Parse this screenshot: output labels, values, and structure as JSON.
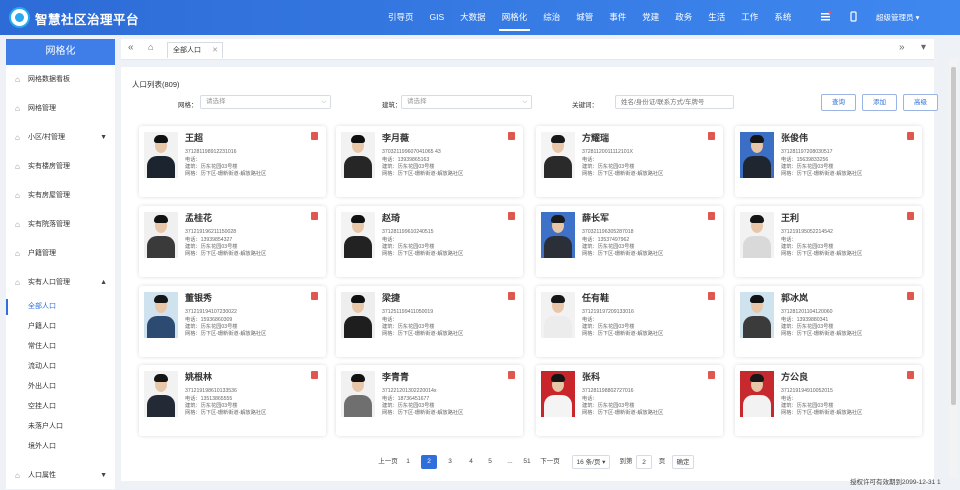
{
  "app": {
    "title": "智慧社区治理平台"
  },
  "topnav": [
    "引导页",
    "GIS",
    "大数据",
    "网格化",
    "综治",
    "城管",
    "事件",
    "党建",
    "政务",
    "生活",
    "工作",
    "系统"
  ],
  "topbar_icons": [
    "hamburger-icon",
    "bell-icon",
    "phone-icon",
    "user-icon"
  ],
  "user": {
    "name": "超级管理员 ▾"
  },
  "sidebar": {
    "title": "网格化",
    "items": [
      {
        "label": "网格数据看板",
        "caret": ""
      },
      {
        "label": "网格管理",
        "caret": ""
      },
      {
        "label": "小区/村管理",
        "caret": "▼"
      },
      {
        "label": "实有楼房管理",
        "caret": ""
      },
      {
        "label": "实有房屋管理",
        "caret": ""
      },
      {
        "label": "实有院落管理",
        "caret": ""
      },
      {
        "label": "户籍管理",
        "caret": ""
      },
      {
        "label": "实有人口管理",
        "caret": "▲"
      }
    ],
    "sub": [
      "全部人口",
      "户籍人口",
      "常住人口",
      "流动人口",
      "外出人口",
      "空挂人口",
      "未落户人口",
      "境外人口"
    ],
    "last": {
      "label": "人口属性",
      "caret": "▼"
    }
  },
  "tabbar": {
    "prev": "«",
    "home": "⌂",
    "tab": "全部人口",
    "tab_close": "✕",
    "next": "»",
    "menu": "▾"
  },
  "content": {
    "title": "人口列表(809)",
    "filters": {
      "grid_label": "网格：",
      "grid_placeholder": "请选择",
      "build_label": "建筑：",
      "build_placeholder": "请选择",
      "kw_label": "关键词：",
      "kw_placeholder": "姓名/身份证/联系方式/车牌号"
    },
    "buttons": {
      "query": "查询",
      "add": "添加",
      "advanced": "高级"
    }
  },
  "people": [
    {
      "name": "王超",
      "id": "371281198912231016",
      "phone": "电话：",
      "building": "建筑：历东花园03号楼",
      "grid": "网格：历下区-珊新街道-解放路社区",
      "bg": "#f2f2f2",
      "cloth": "#1c2430",
      "hair": "#111111"
    },
    {
      "name": "李月薇",
      "id": "370321199607041065 43",
      "phone": "电话：13939865163",
      "building": "建筑：历东花园03号楼",
      "grid": "网格：历下区-珊新街道-解放路社区",
      "bg": "#f2f2f2",
      "cloth": "#262626",
      "hair": "#0e0e0e"
    },
    {
      "name": "方耀瑞",
      "id": "37281120011112101X",
      "phone": "电话：",
      "building": "建筑：历东花园03号楼",
      "grid": "网格：历下区-珊新街道-解放路社区",
      "bg": "#f4f4f4",
      "cloth": "#2a2a2a",
      "hair": "#181818"
    },
    {
      "name": "张俊伟",
      "id": "371281197208030517",
      "phone": "电话：15639833256",
      "building": "建筑：历东花园03号楼",
      "grid": "网格：历下区-珊新街道-解放路社区",
      "bg": "#3b6fc6",
      "cloth": "#1f2630",
      "hair": "#161616"
    },
    {
      "name": "孟桂花",
      "id": "371219196211150028",
      "phone": "电话：13939854327",
      "building": "建筑：历东花园03号楼",
      "grid": "网格：历下区-珊新街道-解放路社区",
      "bg": "#f0f0f0",
      "cloth": "#3a3a3a",
      "hair": "#121212"
    },
    {
      "name": "赵琦",
      "id": "371281199610240515",
      "phone": "电话：",
      "building": "建筑：历东花园03号楼",
      "grid": "网格：历下区-珊新街道-解放路社区",
      "bg": "#f3f3f3",
      "cloth": "#222222",
      "hair": "#101010"
    },
    {
      "name": "薛长军",
      "id": "370321196305287018",
      "phone": "电话：13537497962",
      "building": "建筑：历东花园03号楼",
      "grid": "网格：历下区-珊新街道-解放路社区",
      "bg": "#3e72c9",
      "cloth": "#2b2f38",
      "hair": "#1b1b1b"
    },
    {
      "name": "王利",
      "id": "371219195052214542",
      "phone": "电话：",
      "building": "建筑：历东花园03号楼",
      "grid": "网格：历下区-珊新街道-解放路社区",
      "bg": "#f2f2f2",
      "cloth": "#d9d9d9",
      "hair": "#141414"
    },
    {
      "name": "董银秀",
      "id": "371219194107230022",
      "phone": "电话：15936860309",
      "building": "建筑：历东花园03号楼",
      "grid": "网格：历下区-珊新街道-解放路社区",
      "bg": "#cfe3ef",
      "cloth": "#2d4a73",
      "hair": "#161616"
    },
    {
      "name": "梁捷",
      "id": "371251199411050019",
      "phone": "电话：",
      "building": "建筑：历东花园03号楼",
      "grid": "网格：历下区-珊新街道-解放路社区",
      "bg": "#eeeeee",
      "cloth": "#1e1e1e",
      "hair": "#0f0f0f"
    },
    {
      "name": "任有鞋",
      "id": "371219197209133016",
      "phone": "电话：",
      "building": "建筑：历东花园03号楼",
      "grid": "网格：历下区-珊新街道-解放路社区",
      "bg": "#f2f2f2",
      "cloth": "#ececec",
      "hair": "#171717"
    },
    {
      "name": "郭冰岚",
      "id": "371281201104120060",
      "phone": "电话：13939880341",
      "building": "建筑：历东花园03号楼",
      "grid": "网格：历下区-珊新街道-解放路社区",
      "bg": "#cfe3ef",
      "cloth": "#3b3b3b",
      "hair": "#121212"
    },
    {
      "name": "姚根林",
      "id": "371219198610133536",
      "phone": "电话：13513865555",
      "building": "建筑：历东花园03号楼",
      "grid": "网格：历下区-珊新街道-解放路社区",
      "bg": "#f2f2f2",
      "cloth": "#232a36",
      "hair": "#151515"
    },
    {
      "name": "李青青",
      "id": "371221201302220014x",
      "phone": "电话：18736451677",
      "building": "建筑：历东花园03号楼",
      "grid": "网格：历下区-珊新街道-解放路社区",
      "bg": "#f1f1f1",
      "cloth": "#6f6f6f",
      "hair": "#121212"
    },
    {
      "name": "张科",
      "id": "371281198802727016",
      "phone": "电话：",
      "building": "建筑：历东花园03号楼",
      "grid": "网格：历下区-珊新街道-解放路社区",
      "bg": "#c8262b",
      "cloth": "#f4f4f4",
      "hair": "#141414"
    },
    {
      "name": "方公良",
      "id": "371219194910052015",
      "phone": "电话：",
      "building": "建筑：历东花园03号楼",
      "grid": "网格：历下区-珊新街道-解放路社区",
      "bg": "#c62a2e",
      "cloth": "#f2f2f2",
      "hair": "#171717"
    }
  ],
  "pager": {
    "prev": "上一页",
    "pages": [
      "1",
      "2",
      "3",
      "4",
      "5",
      "...",
      "51"
    ],
    "current": "2",
    "next": "下一页",
    "size": "16 条/页 ▾",
    "goto": "到第",
    "input": "2",
    "unit": "页",
    "confirm": "确定"
  },
  "footer": "授权许可有效期到2099-12-31 1"
}
